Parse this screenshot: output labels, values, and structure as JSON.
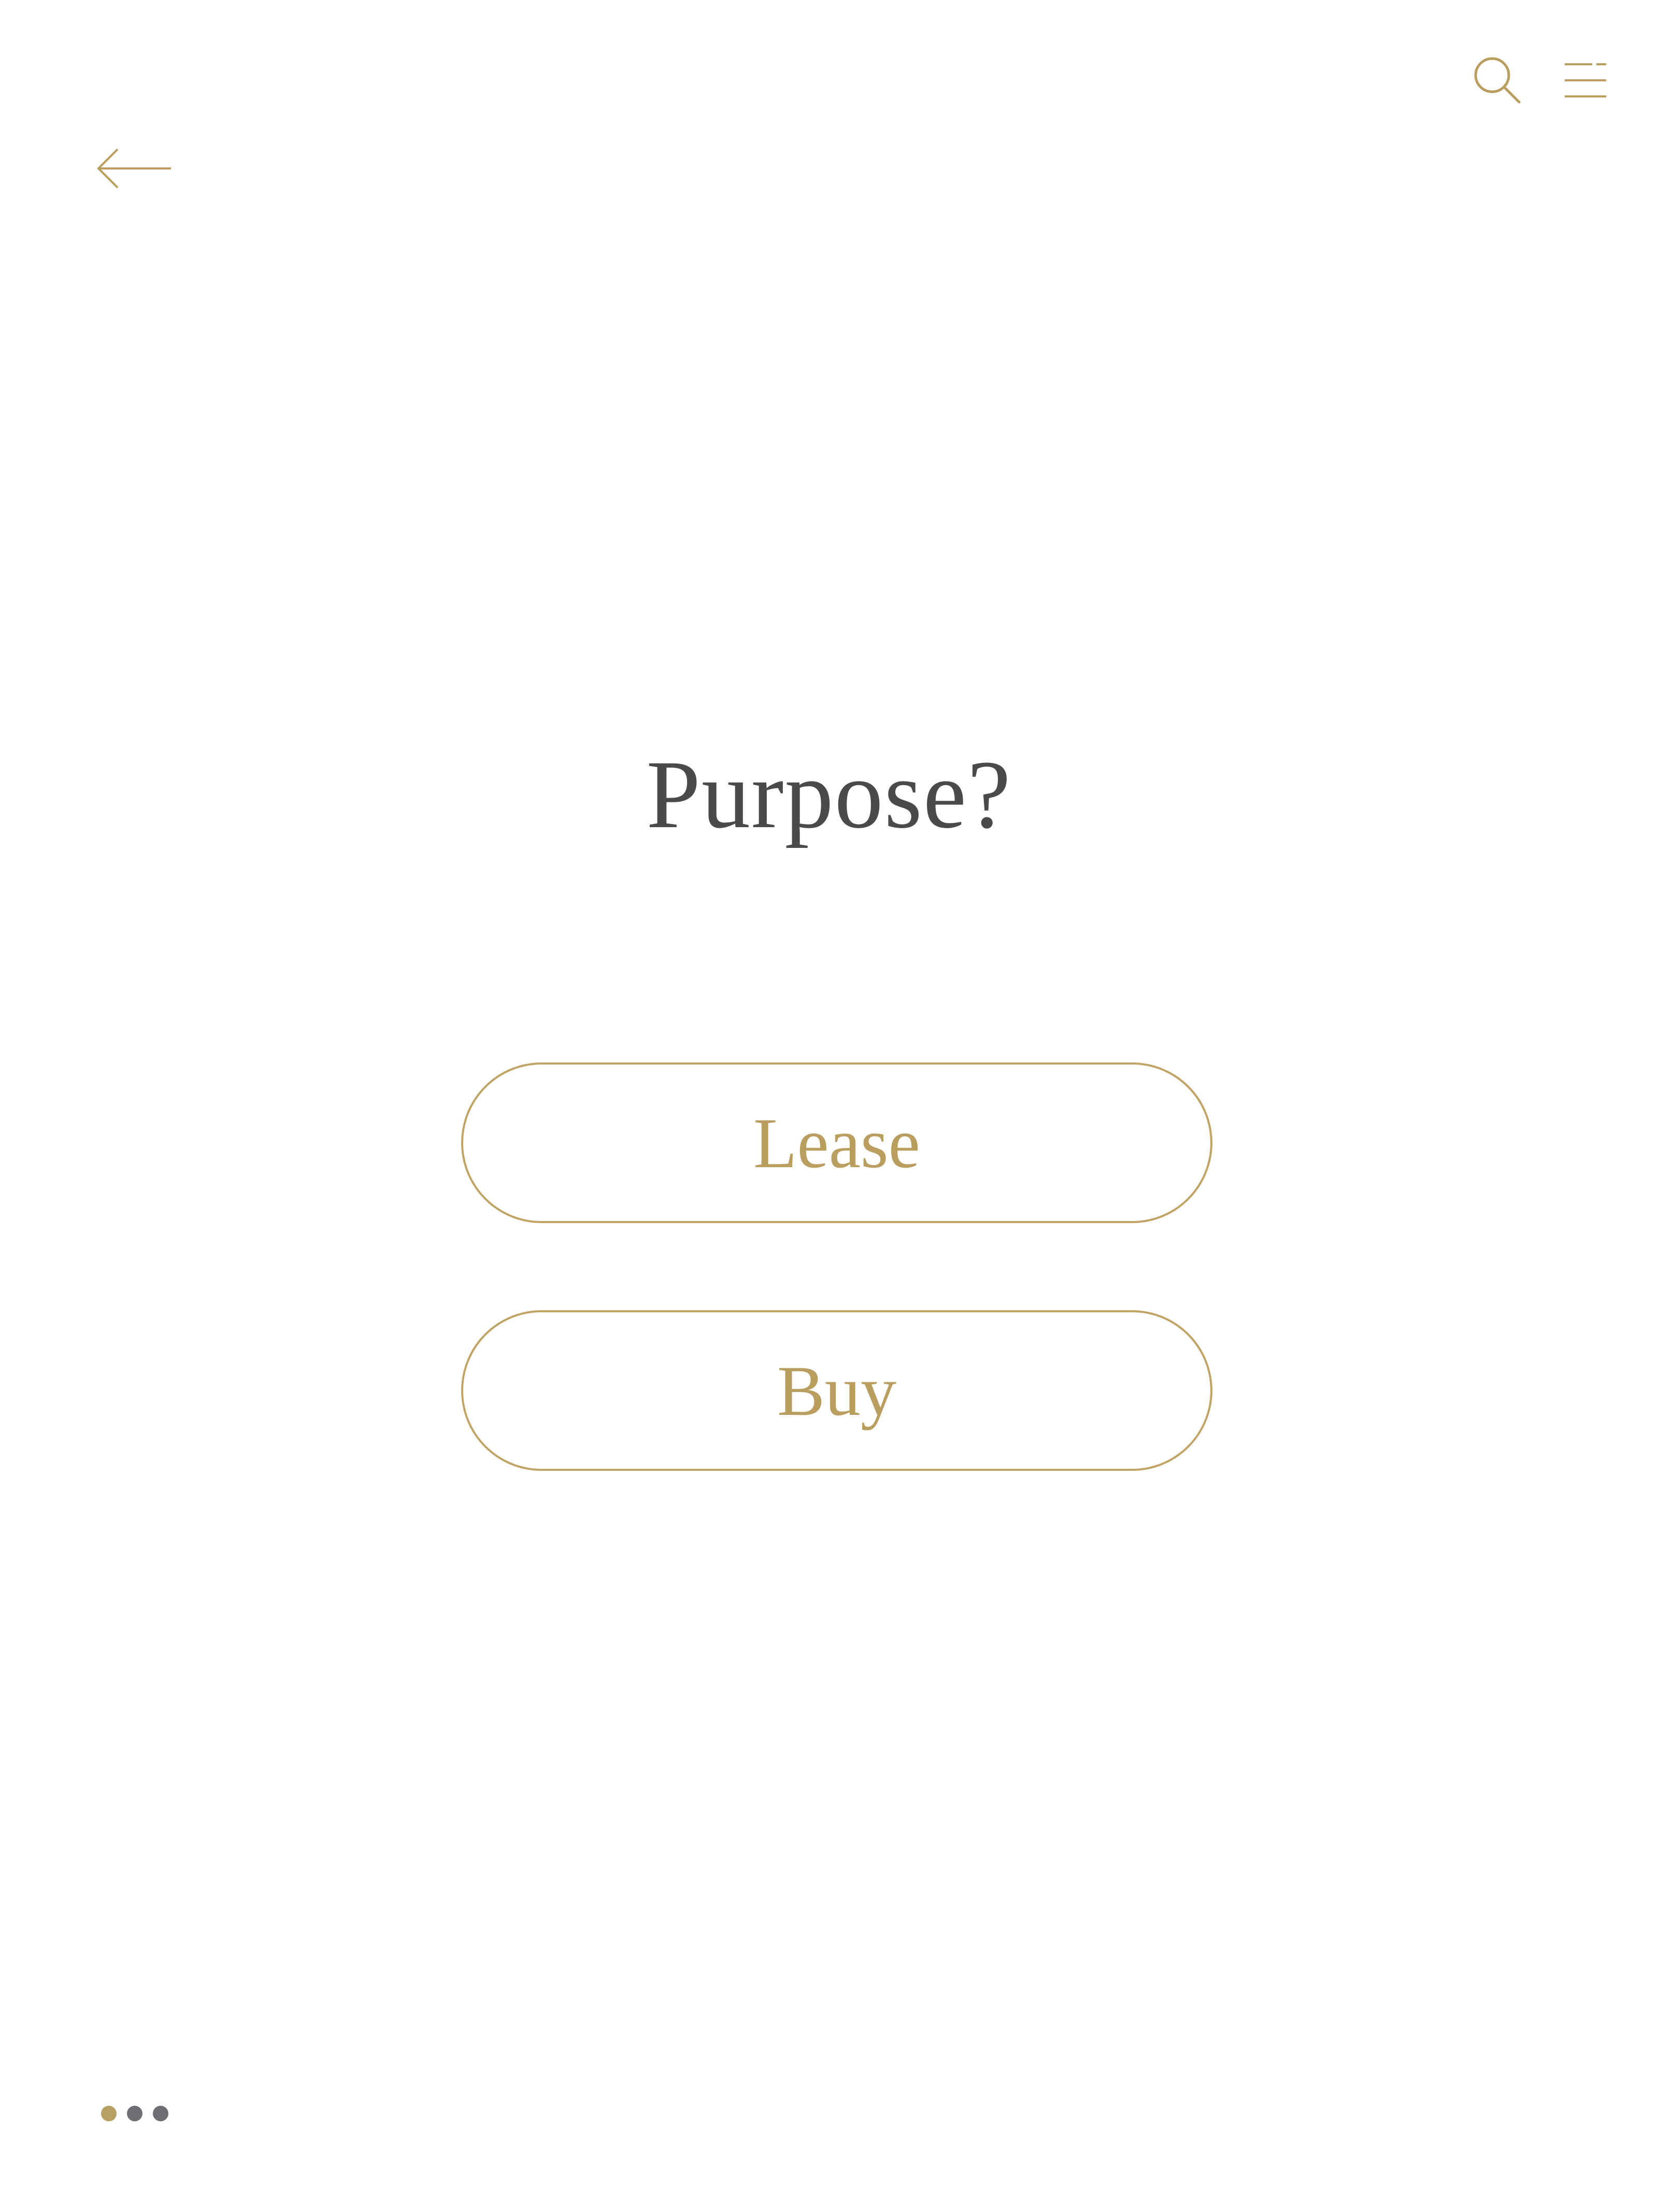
{
  "header": {
    "search_icon": "search-icon",
    "menu_icon": "menu-icon",
    "back_icon": "arrow-left-icon"
  },
  "question": {
    "title": "Purpose?"
  },
  "options": [
    {
      "label": "Lease"
    },
    {
      "label": "Buy"
    }
  ],
  "pagination": {
    "total": 3,
    "active_index": 0
  },
  "colors": {
    "accent": "#b99e5f",
    "title_text": "#4a4a4a",
    "inactive_dot": "#6f6e73",
    "background": "#ffffff"
  }
}
